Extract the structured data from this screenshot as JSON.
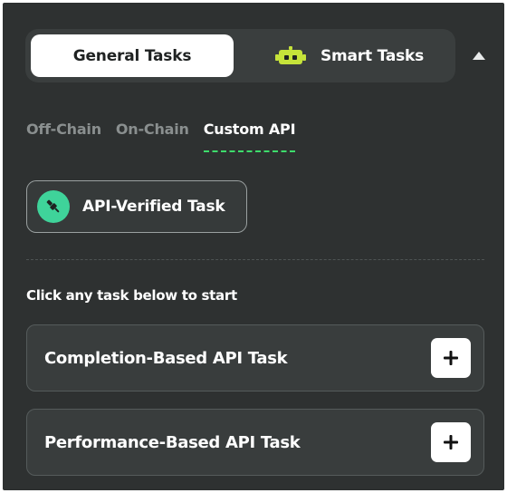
{
  "segmented": {
    "general_label": "General Tasks",
    "smart_label": "Smart Tasks",
    "active": "general",
    "smart_icon": "robot-icon"
  },
  "collapse_icon": "caret-up-icon",
  "tabs": [
    {
      "label": "Off-Chain",
      "active": false
    },
    {
      "label": "On-Chain",
      "active": false
    },
    {
      "label": "Custom API",
      "active": true
    }
  ],
  "api_button": {
    "label": "API-Verified Task",
    "icon": "plug-icon",
    "icon_color": "#3fd39a"
  },
  "hint": "Click any task below to start",
  "tasks": [
    {
      "title": "Completion-Based API Task",
      "action_icon": "plus-icon"
    },
    {
      "title": "Performance-Based API Task",
      "action_icon": "plus-icon"
    }
  ],
  "colors": {
    "panel_bg": "#2e3131",
    "accent_green": "#3ddc6b",
    "robot_yellow": "#c6e33a"
  }
}
